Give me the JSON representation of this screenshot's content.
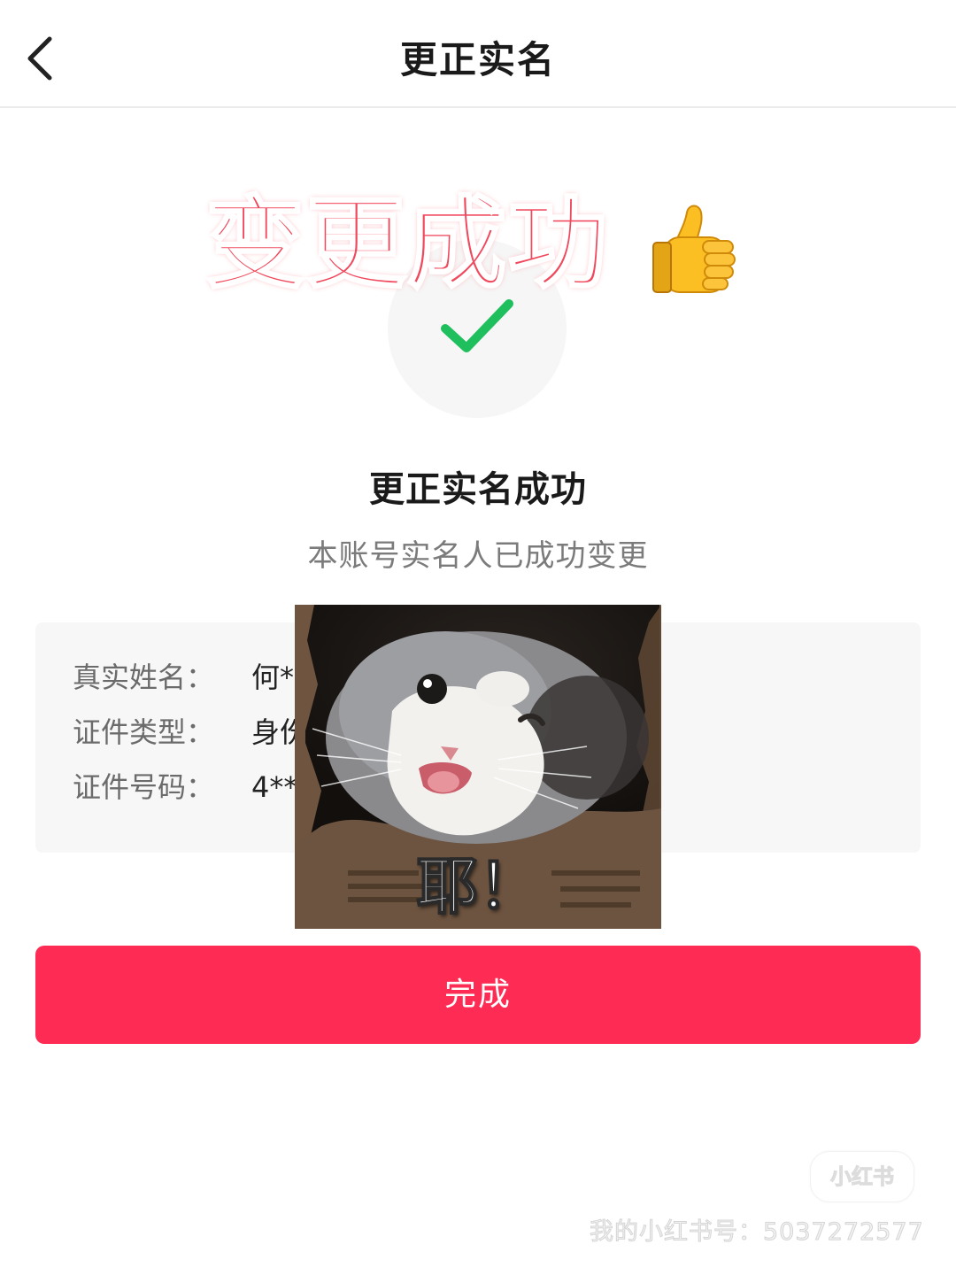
{
  "header": {
    "title": "更正实名",
    "back_icon": "chevron-left-icon"
  },
  "overlay_banner": {
    "text": "变更成功",
    "emoji": "thumbs-up-icon",
    "color": "#f0485c"
  },
  "result": {
    "icon": "check-icon",
    "icon_color": "#1fbf5e",
    "title": "更正实名成功",
    "subtitle": "本账号实名人已成功变更"
  },
  "info": {
    "rows": [
      {
        "label": "真实姓名：",
        "value": "何*"
      },
      {
        "label": "证件类型：",
        "value": "身份"
      },
      {
        "label": "证件号码：",
        "value": "4**"
      }
    ]
  },
  "meme": {
    "caption": "耶！",
    "subject": "cat-photo"
  },
  "actions": {
    "done_label": "完成",
    "done_color": "#fe2c55"
  },
  "watermark": {
    "logo": "小红书",
    "text": "我的小红书号：5037272577"
  }
}
